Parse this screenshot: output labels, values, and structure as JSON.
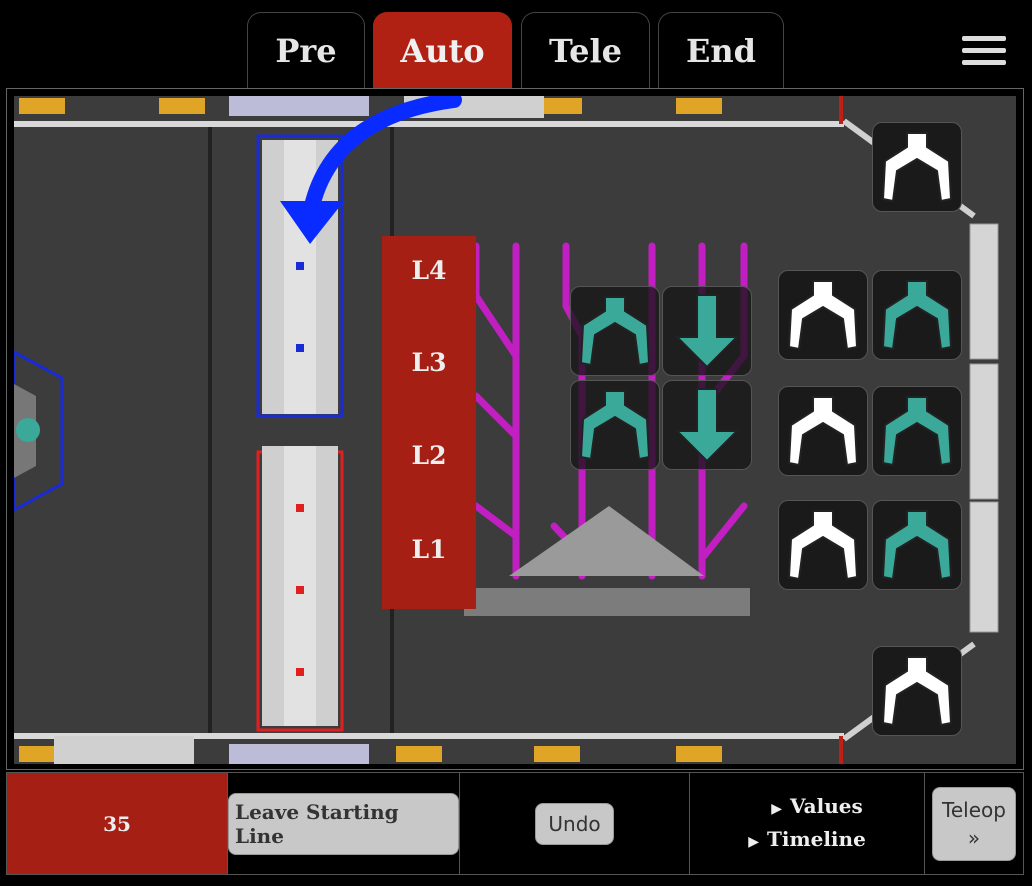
{
  "tabs": [
    {
      "label": "Pre",
      "active": false
    },
    {
      "label": "Auto",
      "active": true
    },
    {
      "label": "Tele",
      "active": false
    },
    {
      "label": "End",
      "active": false
    }
  ],
  "menu_icon": "hamburger-menu-icon",
  "field": {
    "reef_levels": [
      "L4",
      "L3",
      "L2",
      "L1"
    ],
    "colors": {
      "alliance_red": "#a51f14",
      "teal": "#3aa99a",
      "blue_arrow": "#0a2bff",
      "purple": "#c21fc2"
    },
    "icons": {
      "pickup_white": "claw-white-icon",
      "pickup_teal": "claw-teal-icon",
      "drop_teal": "arrow-down-teal-icon",
      "path_arrow": "curved-arrow-icon"
    }
  },
  "footer": {
    "score": "35",
    "leave_label": "Leave Starting Line",
    "undo_label": "Undo",
    "values_label": "Values",
    "timeline_label": "Timeline",
    "teleop_label": "Teleop",
    "teleop_arrow": "»"
  }
}
